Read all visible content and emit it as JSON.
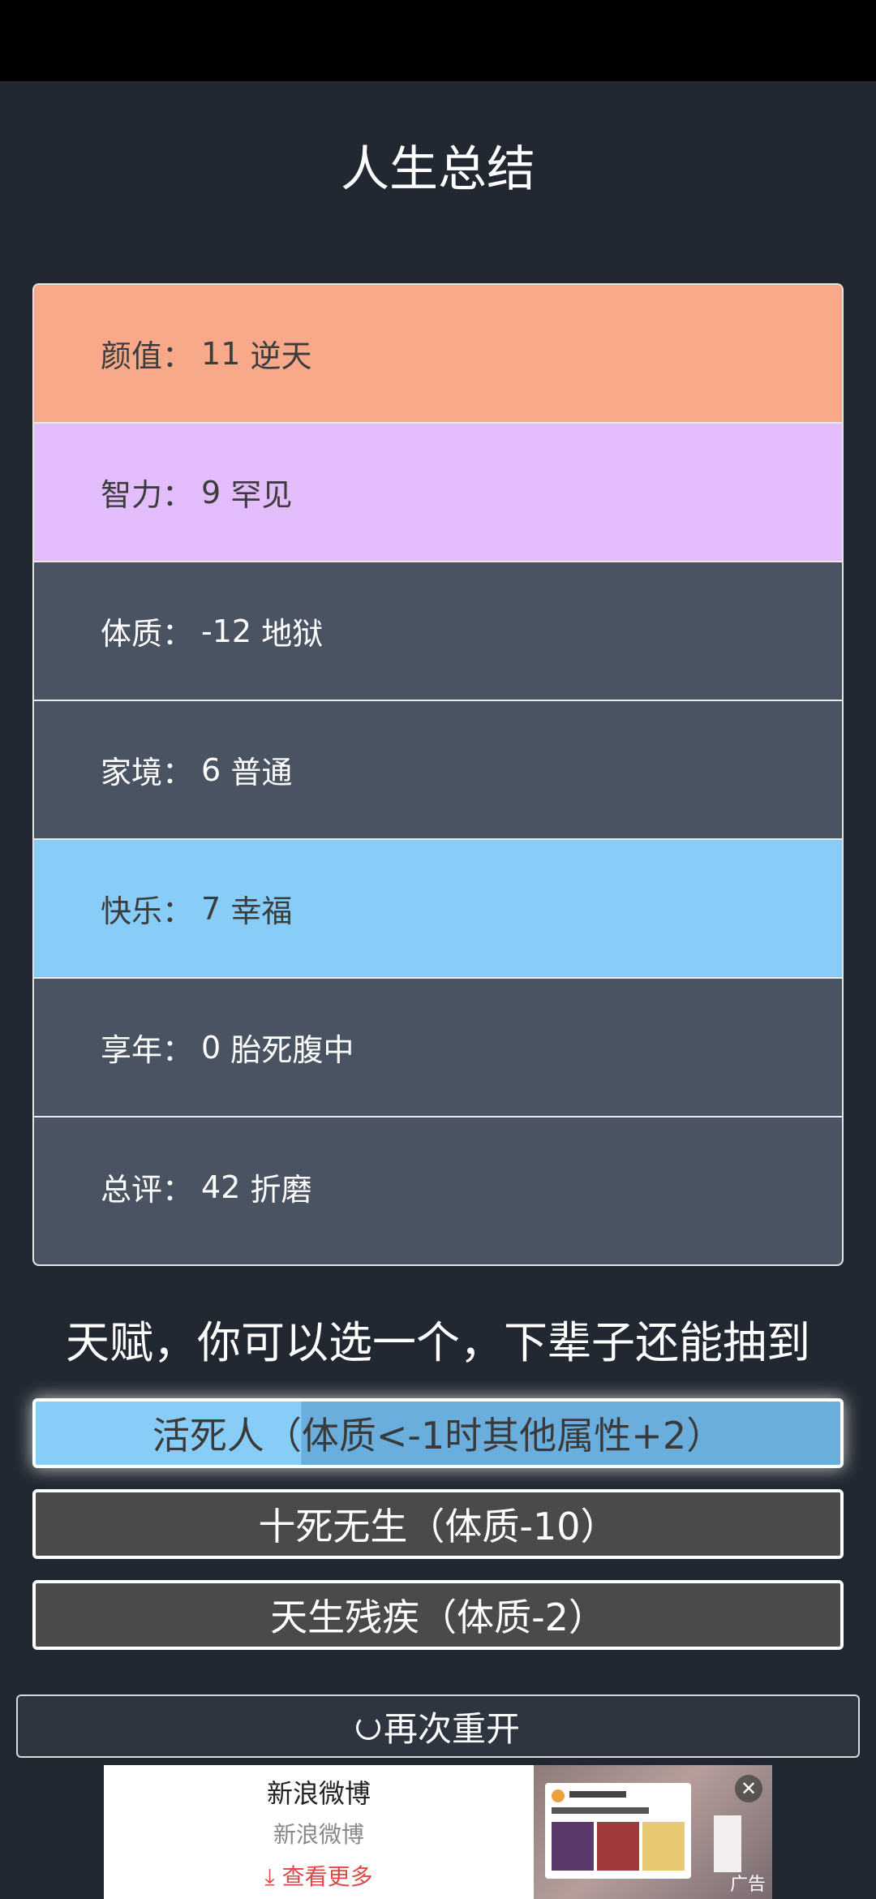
{
  "page_title": "人生总结",
  "summary": [
    {
      "label": "颜值",
      "value": "11",
      "grade": "逆天",
      "color": "#f8a98a"
    },
    {
      "label": "智力",
      "value": "9",
      "grade": "罕见",
      "color": "#e3bdfc"
    },
    {
      "label": "体质",
      "value": "-12",
      "grade": "地狱",
      "color": "#4a5362"
    },
    {
      "label": "家境",
      "value": "6",
      "grade": "普通",
      "color": "#4a5362"
    },
    {
      "label": "快乐",
      "value": "7",
      "grade": "幸福",
      "color": "#87cdf8"
    },
    {
      "label": "享年",
      "value": "0",
      "grade": "胎死腹中",
      "color": "#4a5362"
    },
    {
      "label": "总评",
      "value": "42",
      "grade": "折磨",
      "color": "#4a5362"
    }
  ],
  "talent_title": "天赋，你可以选一个，下辈子还能抽到",
  "talents": [
    {
      "label": "活死人（体质<-1时其他属性+2）",
      "selected": true
    },
    {
      "label": "十死无生（体质-10）",
      "selected": false
    },
    {
      "label": "天生残疾（体质-2）",
      "selected": false
    }
  ],
  "restart_label": "再次重开",
  "ad": {
    "brand": "新浪微博",
    "subtitle": "新浪微博",
    "more": "⤓ 查看更多",
    "tag": "广告",
    "close": "✕"
  }
}
